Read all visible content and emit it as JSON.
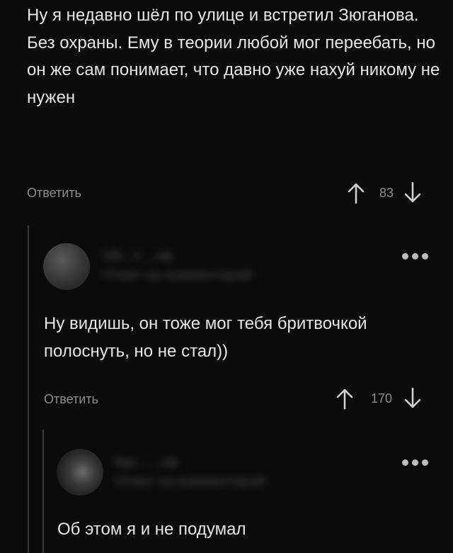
{
  "comments": [
    {
      "text": "Ну я недавно шёл по улице и встретил Зюганова. Без охраны. Ему в теории любой мог переебать, но он же сам понимает, что давно уже нахуй никому не нужен",
      "reply_label": "Ответить",
      "score": "83"
    },
    {
      "author": "Vik...v ...ов",
      "subtitle": "Ответ на комментарий",
      "text": "Ну видишь, он тоже мог тебя бритвочкой полоснуть, но не стал))",
      "reply_label": "Ответить",
      "score": "170"
    },
    {
      "author": "bar... ...ов",
      "subtitle": "Ответ на комментарий",
      "text": "Об этом я и не подумал"
    }
  ],
  "icons": {
    "upvote": "arrow-up-icon",
    "downvote": "arrow-down-icon",
    "more": "more-dots-icon"
  },
  "colors": {
    "background": "#0b0b0b",
    "text": "#e6e6e6",
    "muted": "#8e8e8e"
  }
}
